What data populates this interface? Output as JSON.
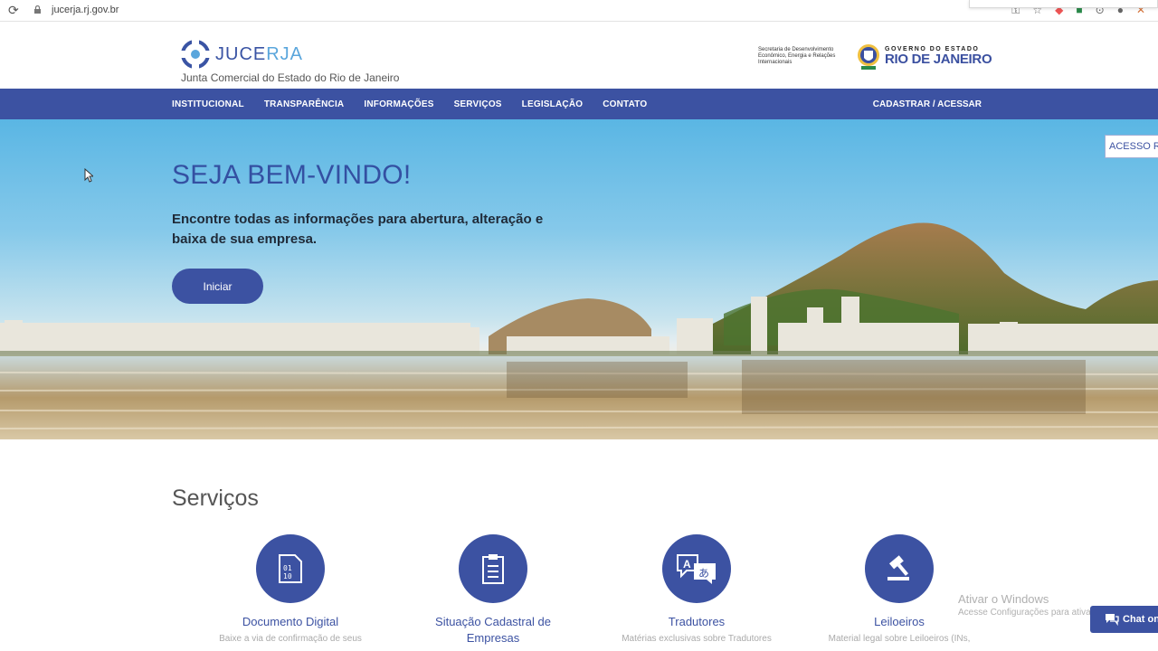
{
  "browser": {
    "url": "jucerja.rj.gov.br"
  },
  "header": {
    "logo_text_a": "JUCE",
    "logo_text_b": "RJA",
    "subtitle": "Junta Comercial do Estado do Rio de Janeiro",
    "secretaria": "Secretaria de Desenvolvimento Econômico, Energia e Relações Internacionais",
    "gov_small": "GOVERNO DO ESTADO",
    "gov_big": "RIO DE JANEIRO"
  },
  "nav": {
    "items": [
      "INSTITUCIONAL",
      "TRANSPARÊNCIA",
      "INFORMAÇÕES",
      "SERVIÇOS",
      "LEGISLAÇÃO",
      "CONTATO"
    ],
    "login": "CADASTRAR / ACESSAR"
  },
  "hero": {
    "title": "SEJA BEM-VINDO!",
    "text": "Encontre todas as informações para abertura, alteração e baixa de sua empresa.",
    "button": "Iniciar",
    "quick_access": "ACESSO RÁ"
  },
  "services": {
    "title": "Serviços",
    "items": [
      {
        "name": "Documento Digital",
        "desc": "Baixe a via de confirmação de seus",
        "icon": "binary-document-icon"
      },
      {
        "name": "Situação Cadastral de Empresas",
        "desc": "",
        "icon": "clipboard-icon"
      },
      {
        "name": "Tradutores",
        "desc": "Matérias exclusivas sobre Tradutores",
        "icon": "translate-icon"
      },
      {
        "name": "Leiloeiros",
        "desc": "Material legal sobre Leiloeiros (INs,",
        "icon": "gavel-icon"
      }
    ]
  },
  "windows_notice": {
    "title": "Ativar o Windows",
    "text": "Acesse Configurações para ativar o Windows."
  },
  "chat": {
    "label": "Chat on"
  },
  "colors": {
    "primary": "#3c52a2",
    "accent": "#5aa6dc"
  }
}
